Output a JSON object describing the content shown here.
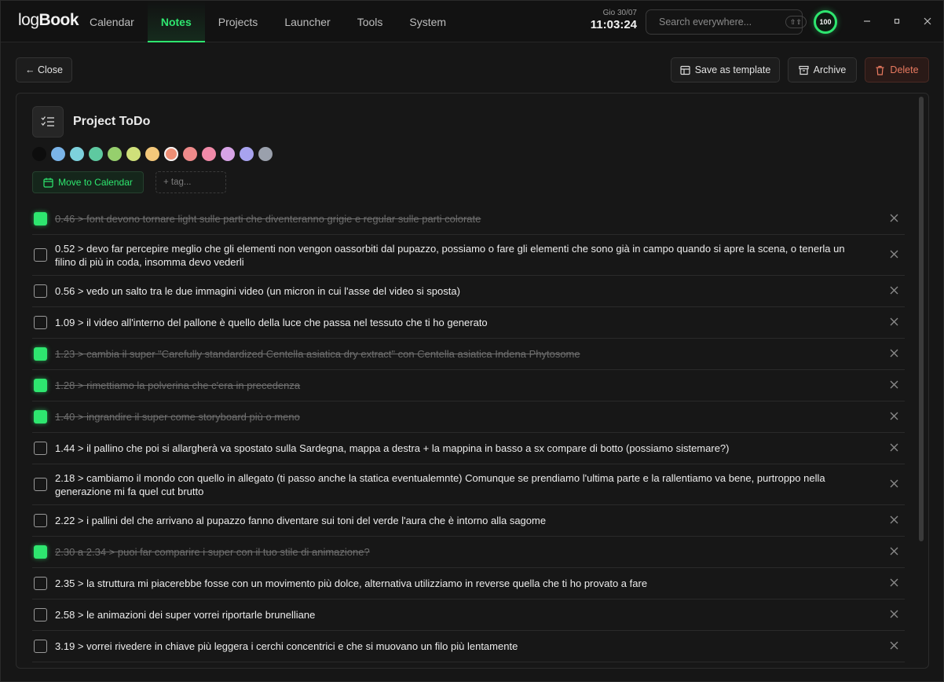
{
  "app": {
    "logo_bold": "log",
    "logo_rest": "Book"
  },
  "nav": [
    {
      "label": "Calendar",
      "active": false
    },
    {
      "label": "Notes",
      "active": true
    },
    {
      "label": "Projects",
      "active": false
    },
    {
      "label": "Launcher",
      "active": false
    },
    {
      "label": "Tools",
      "active": false
    },
    {
      "label": "System",
      "active": false
    }
  ],
  "clock": {
    "date": "Gio 30/07",
    "time": "11:03:24"
  },
  "search": {
    "placeholder": "Search everywhere...",
    "shortcut": "⇧⇧"
  },
  "badge": "100",
  "actions": {
    "close": "← Close",
    "save_template": "Save as template",
    "archive": "Archive",
    "delete": "Delete"
  },
  "note": {
    "title": "Project ToDo",
    "colors": [
      "#0d0d0d",
      "#7ab4e8",
      "#7dd1dc",
      "#5ec9a0",
      "#96cf6d",
      "#cfe07a",
      "#f4c87a",
      "#ee8e74",
      "#ee8a8a",
      "#f08aa8",
      "#d7a3e6",
      "#a8a3ef",
      "#9aa0ac"
    ],
    "selected_color_index": 7,
    "move_to_calendar": "Move to Calendar",
    "tag_placeholder": "+ tag..."
  },
  "todos": [
    {
      "text": "0.46 > font devono tornare light sulle parti che diventeranno grigie e regular sulle parti colorate",
      "done": true
    },
    {
      "text": "0.52 > devo far percepire meglio che gli elementi non vengon oassorbiti dal pupazzo, possiamo o fare gli elementi che sono già in campo quando si apre la scena, o tenerla un filino di più in coda, insomma devo vederli",
      "done": false
    },
    {
      "text": "0.56 > vedo un salto tra le due immagini video (un micron in cui l'asse del video si sposta)",
      "done": false
    },
    {
      "text": "1.09 > il video all'interno del pallone è quello della luce che passa nel tessuto che ti ho generato",
      "done": false
    },
    {
      "text": "1.23 > cambia il super \"Carefully standardized Centella asiatica dry extract\" con Centella asiatica Indena Phytosome",
      "done": true
    },
    {
      "text": "1.28 > rimettiamo la polverina che c'era in precedenza",
      "done": true
    },
    {
      "text": "1.40 > ingrandire il super come storyboard più o meno",
      "done": true
    },
    {
      "text": "1.44 > il pallino che poi si allargherà va spostato sulla Sardegna, mappa a destra + la mappina in basso a sx compare di botto (possiamo sistemare?)",
      "done": false
    },
    {
      "text": "2.18 > cambiamo il mondo con quello in allegato (ti passo anche la statica eventualemnte) Comunque se prendiamo l'ultima parte e la rallentiamo va bene, purtroppo nella generazione mi fa quel cut brutto",
      "done": false
    },
    {
      "text": "2.22 > i pallini del che arrivano al pupazzo fanno diventare sui toni del verde l'aura che è intorno alla sagome",
      "done": false
    },
    {
      "text": "2.30 a 2.34 > puoi far comparire i super con il tuo stile di animazione?",
      "done": true
    },
    {
      "text": "2.35 > la struttura mi piacerebbe fosse con un movimento più dolce, alternativa utilizziamo in reverse quella che ti ho provato a fare",
      "done": false
    },
    {
      "text": "2.58 > le animazioni dei super vorrei riportarle brunelliane",
      "done": false
    },
    {
      "text": "3.19 > vorrei rivedere in chiave più leggera i cerchi concentrici e che si muovano un filo più lentamente",
      "done": false
    }
  ]
}
